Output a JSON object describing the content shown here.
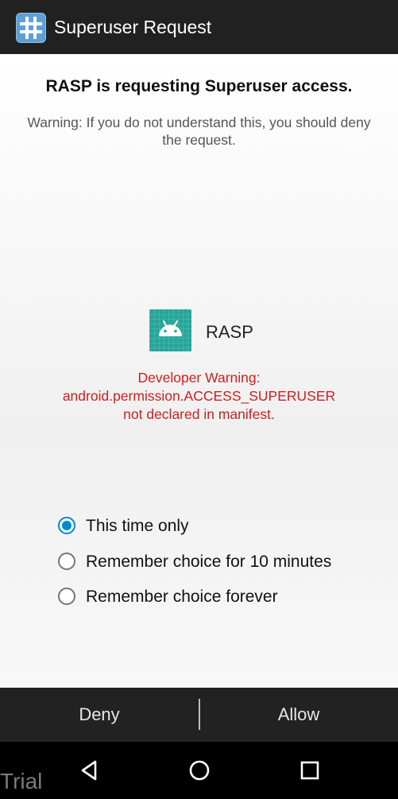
{
  "titlebar": {
    "title": "Superuser Request",
    "app_icon": "superuser-hash-icon"
  },
  "dialog": {
    "heading": "RASP is requesting Superuser access.",
    "warning": "Warning: If you do not understand this, you should deny the request.",
    "app": {
      "name": "RASP",
      "icon": "android-app-icon"
    },
    "developer_warning": {
      "line1": "Developer Warning:",
      "line2": "android.permission.ACCESS_SUPERUSER",
      "line3": "not declared in manifest."
    }
  },
  "options": [
    {
      "label": "This time only",
      "checked": true
    },
    {
      "label": "Remember choice for 10 minutes",
      "checked": false
    },
    {
      "label": "Remember choice forever",
      "checked": false
    }
  ],
  "actions": {
    "deny": "Deny",
    "allow": "Allow"
  },
  "navbar": {
    "back": "back-icon",
    "home": "home-icon",
    "recents": "recents-icon"
  },
  "watermark": "Trial",
  "colors": {
    "accent": "#0288d1",
    "warning": "#cc1f1f",
    "app_icon_bg": "#26a69a"
  }
}
